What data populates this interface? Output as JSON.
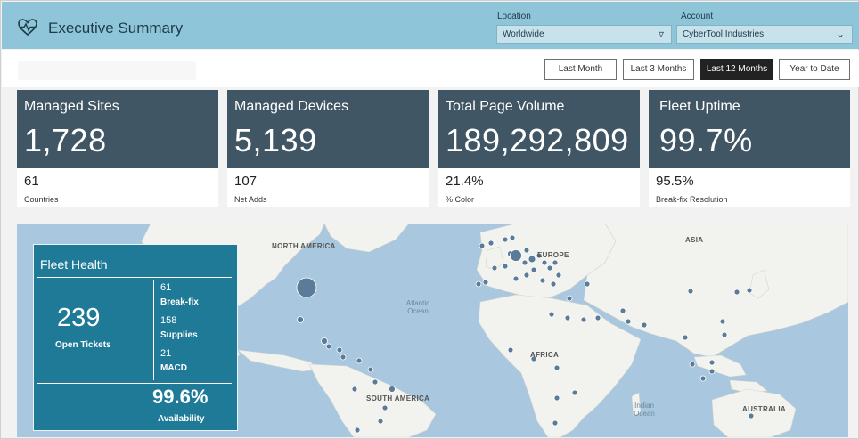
{
  "header": {
    "title": "Executive Summary",
    "location": {
      "label": "Location",
      "value": "Worldwide",
      "icon": "filter-icon"
    },
    "account": {
      "label": "Account",
      "value": "CyberTool Industries",
      "icon": "chevron-down-icon"
    },
    "logo_icon": "heartbeat-icon"
  },
  "periods": [
    {
      "label": "Last Month",
      "active": false
    },
    {
      "label": "Last 3 Months",
      "active": false
    },
    {
      "label": "Last 12 Months",
      "active": true
    },
    {
      "label": "Year to Date",
      "active": false
    }
  ],
  "kpis": [
    {
      "title": "Managed Sites",
      "value": "1,728",
      "sub_value": "61",
      "sub_label": "Countries"
    },
    {
      "title": "Managed Devices",
      "value": "5,139",
      "sub_value": "107",
      "sub_label": "Net Adds"
    },
    {
      "title": "Total Page Volume",
      "value": "189,292,809",
      "sub_value": "21.4%",
      "sub_label": "% Color"
    },
    {
      "title": "Fleet Uptime",
      "value": "99.7%",
      "sub_value": "95.5%",
      "sub_label": "Break-fix Resolution"
    }
  ],
  "map": {
    "continent_labels": [
      "NORTH AMERICA",
      "EUROPE",
      "ASIA",
      "AFRICA",
      "SOUTH AMERICA",
      "AUSTRALIA"
    ],
    "ocean_labels": [
      "Atlantic Ocean",
      "Indian Ocean"
    ]
  },
  "fleet_health": {
    "title": "Fleet Health",
    "open_tickets": "239",
    "open_tickets_label": "Open Tickets",
    "breakdown": [
      {
        "count": "61",
        "label": "Break-fix"
      },
      {
        "count": "158",
        "label": "Supplies"
      },
      {
        "count": "21",
        "label": "MACD"
      }
    ],
    "availability": "99.6%",
    "availability_label": "Availability"
  },
  "colors": {
    "header_bg": "#8fc5d8",
    "kpi_band": "#415664",
    "fleet_panel": "#1e7a96",
    "map_ocean": "#a9c7de",
    "map_land": "#f2f2ef",
    "bubble": "#5b7c99",
    "active_button": "#222222"
  }
}
